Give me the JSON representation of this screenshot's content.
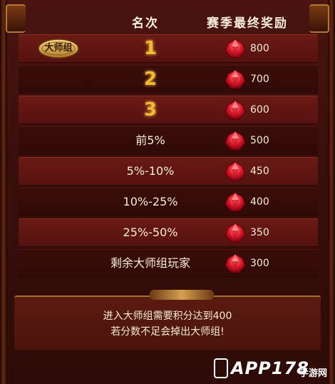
{
  "header": {
    "rank_label": "名次",
    "reward_label": "赛季最终奖励"
  },
  "badge": {
    "label": "大师组",
    "icon": "master-badge-icon"
  },
  "rows": [
    {
      "rank": "1",
      "amount": "800",
      "style": "big",
      "shade": "light"
    },
    {
      "rank": "2",
      "amount": "700",
      "style": "big",
      "shade": "dark"
    },
    {
      "rank": "3",
      "amount": "600",
      "style": "big",
      "shade": "light"
    },
    {
      "rank": "前5%",
      "amount": "500",
      "style": "text",
      "shade": "dark"
    },
    {
      "rank": "5%-10%",
      "amount": "450",
      "style": "text",
      "shade": "light"
    },
    {
      "rank": "10%-25%",
      "amount": "400",
      "style": "text",
      "shade": "dark"
    },
    {
      "rank": "25%-50%",
      "amount": "350",
      "style": "text",
      "shade": "light"
    },
    {
      "rank": "剩余大师组玩家",
      "amount": "300",
      "style": "text",
      "shade": "dark"
    }
  ],
  "reward_icon": "red-gem-icon",
  "footer": {
    "line1": "进入大师组需要积分达到400",
    "line2": "若分数不足会掉出大师组!"
  },
  "watermark": {
    "main": "APP178",
    "sub": "手游网"
  },
  "colors": {
    "gold": "#f6b830",
    "text": "#f4ecd8",
    "row_light": "#6a1a14",
    "row_dark": "#3a0c09"
  }
}
